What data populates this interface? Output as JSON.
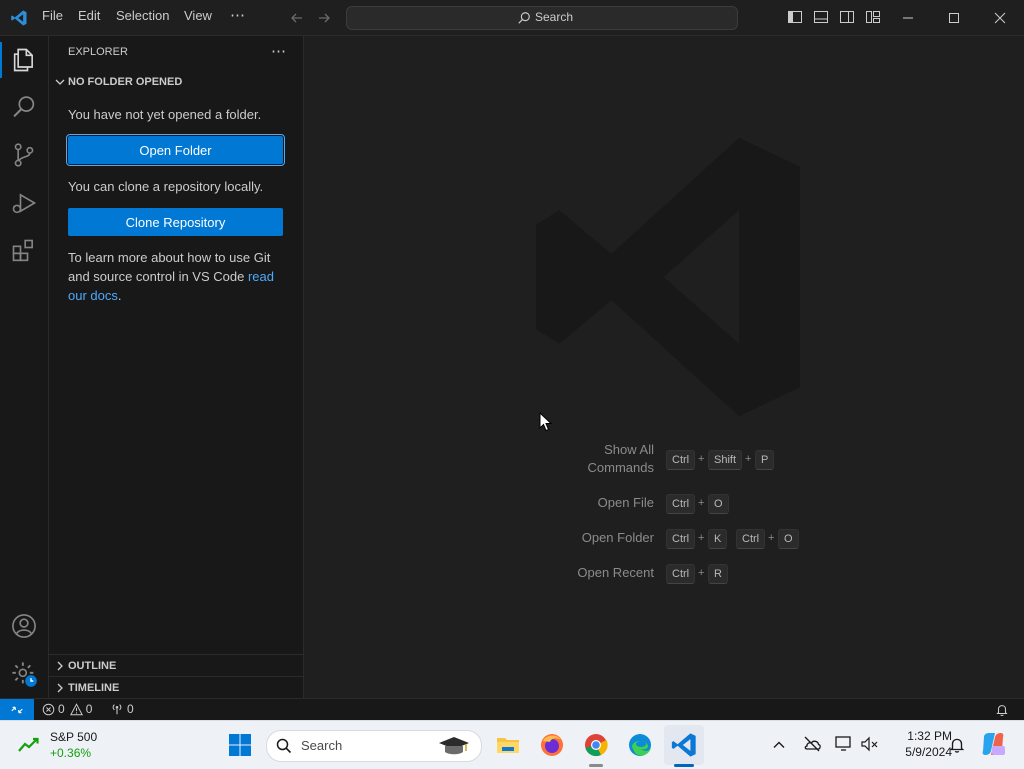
{
  "menu": {
    "items": [
      "File",
      "Edit",
      "Selection",
      "View"
    ],
    "more": "⋯"
  },
  "search": {
    "label": "Search"
  },
  "sidebar": {
    "title": "EXPLORER",
    "more": "⋯",
    "section": "NO FOLDER OPENED",
    "no_folder_text": "You have not yet opened a folder.",
    "open_folder_button": "Open Folder",
    "clone_text": "You can clone a repository locally.",
    "clone_button": "Clone Repository",
    "learn_text": "To learn more about how to use Git and source control in VS Code ",
    "learn_link": "read our docs",
    "learn_end": ".",
    "outline": "OUTLINE",
    "timeline": "TIMELINE"
  },
  "editor": {
    "commands": [
      {
        "label_line1": "Show All",
        "label_line2": "Commands",
        "keys": [
          "Ctrl",
          "+",
          "Shift",
          "+",
          "P"
        ]
      },
      {
        "label_line1": "Open File",
        "keys": [
          "Ctrl",
          "+",
          "O"
        ]
      },
      {
        "label_line1": "Open Folder",
        "keys": [
          "Ctrl",
          "+",
          "K",
          "Ctrl",
          "+",
          "O"
        ]
      },
      {
        "label_line1": "Open Recent",
        "keys": [
          "Ctrl",
          "+",
          "R"
        ]
      }
    ]
  },
  "status": {
    "errors": "0",
    "warnings": "0",
    "ports": "0"
  },
  "taskbar": {
    "stock_name": "S&P 500",
    "stock_change": "+0.36%",
    "search_label": "Search",
    "time": "1:32 PM",
    "date": "5/9/2024"
  },
  "colors": {
    "accent": "#0078d4",
    "link": "#4daafc",
    "stock_up": "#13a10e"
  }
}
